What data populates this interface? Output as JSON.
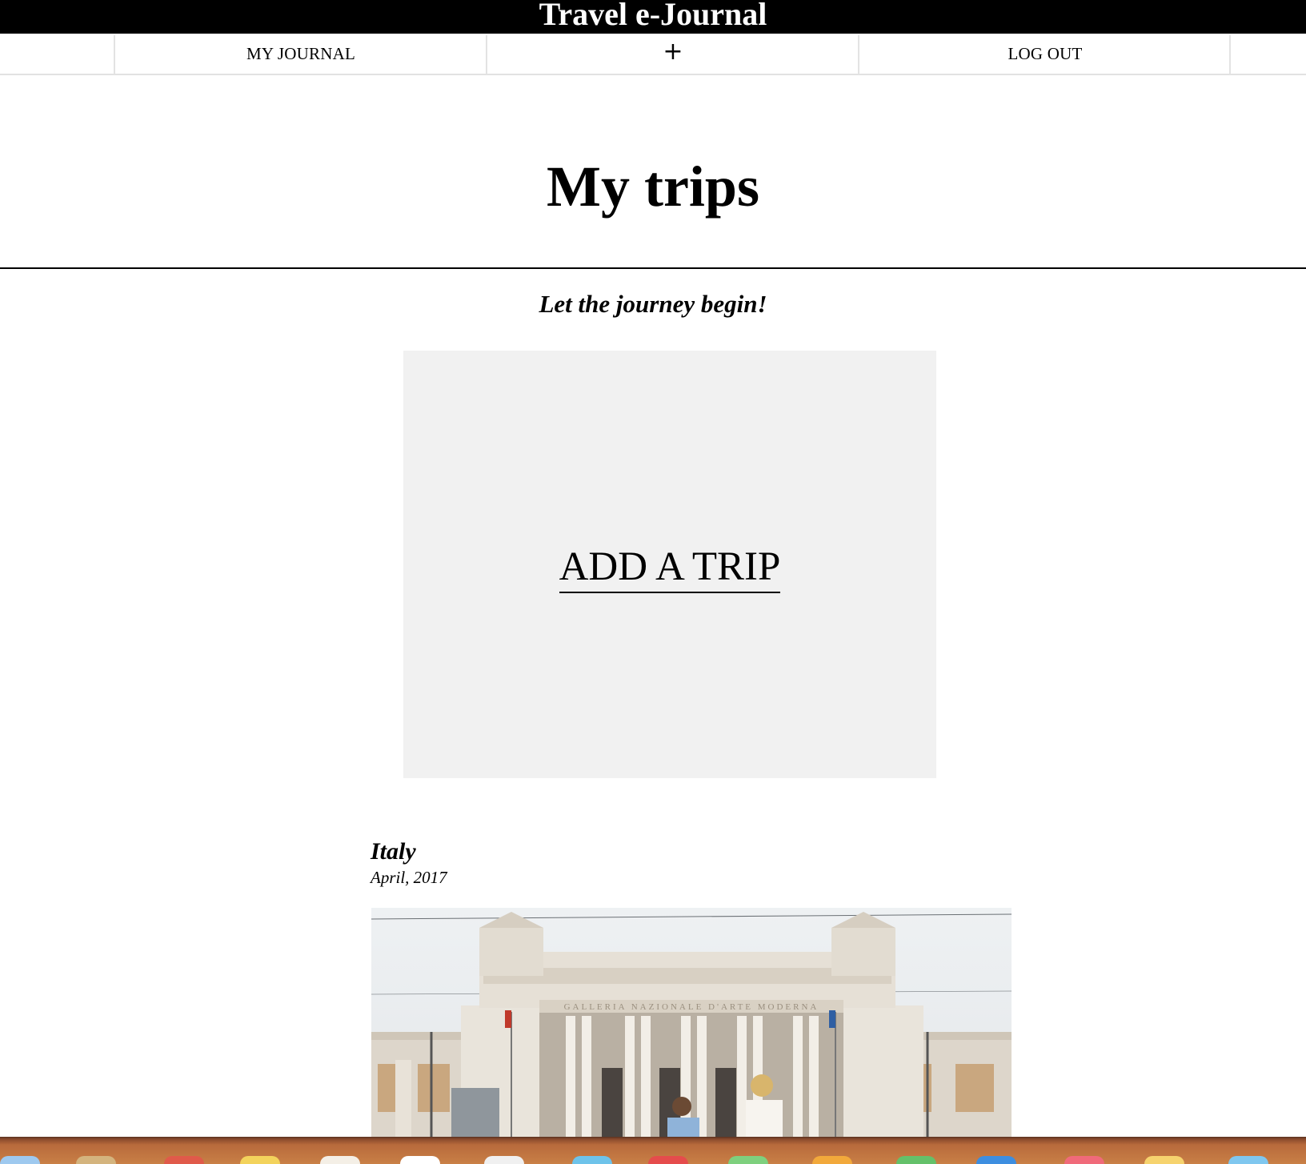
{
  "header": {
    "title": "Travel e-Journal"
  },
  "nav": {
    "my_journal_label": "MY JOURNAL",
    "add_label": "+",
    "logout_label": "LOG OUT"
  },
  "main": {
    "page_title": "My trips",
    "tagline": "Let the journey begin!",
    "add_trip_label": "ADD A TRIP"
  },
  "trips": [
    {
      "name": "Italy",
      "date": "April, 2017",
      "photo_caption": "GALLERIA NAZIONALE D'ARTE MODERNA"
    }
  ],
  "colors": {
    "header_bg": "#000000",
    "header_text": "#ffffff",
    "card_bg": "#f1f1f1",
    "divider": "#000000",
    "nav_border": "#e2e2e2"
  },
  "dock": {
    "icons": [
      "safari-icon",
      "finder-icon",
      "calendar-icon",
      "notes-icon",
      "mail-icon",
      "itunes-icon",
      "messages-icon",
      "maps-icon",
      "facetime-icon",
      "photos-icon",
      "store-icon",
      "preferences-icon",
      "chrome-icon",
      "music-icon",
      "app-icon"
    ]
  }
}
